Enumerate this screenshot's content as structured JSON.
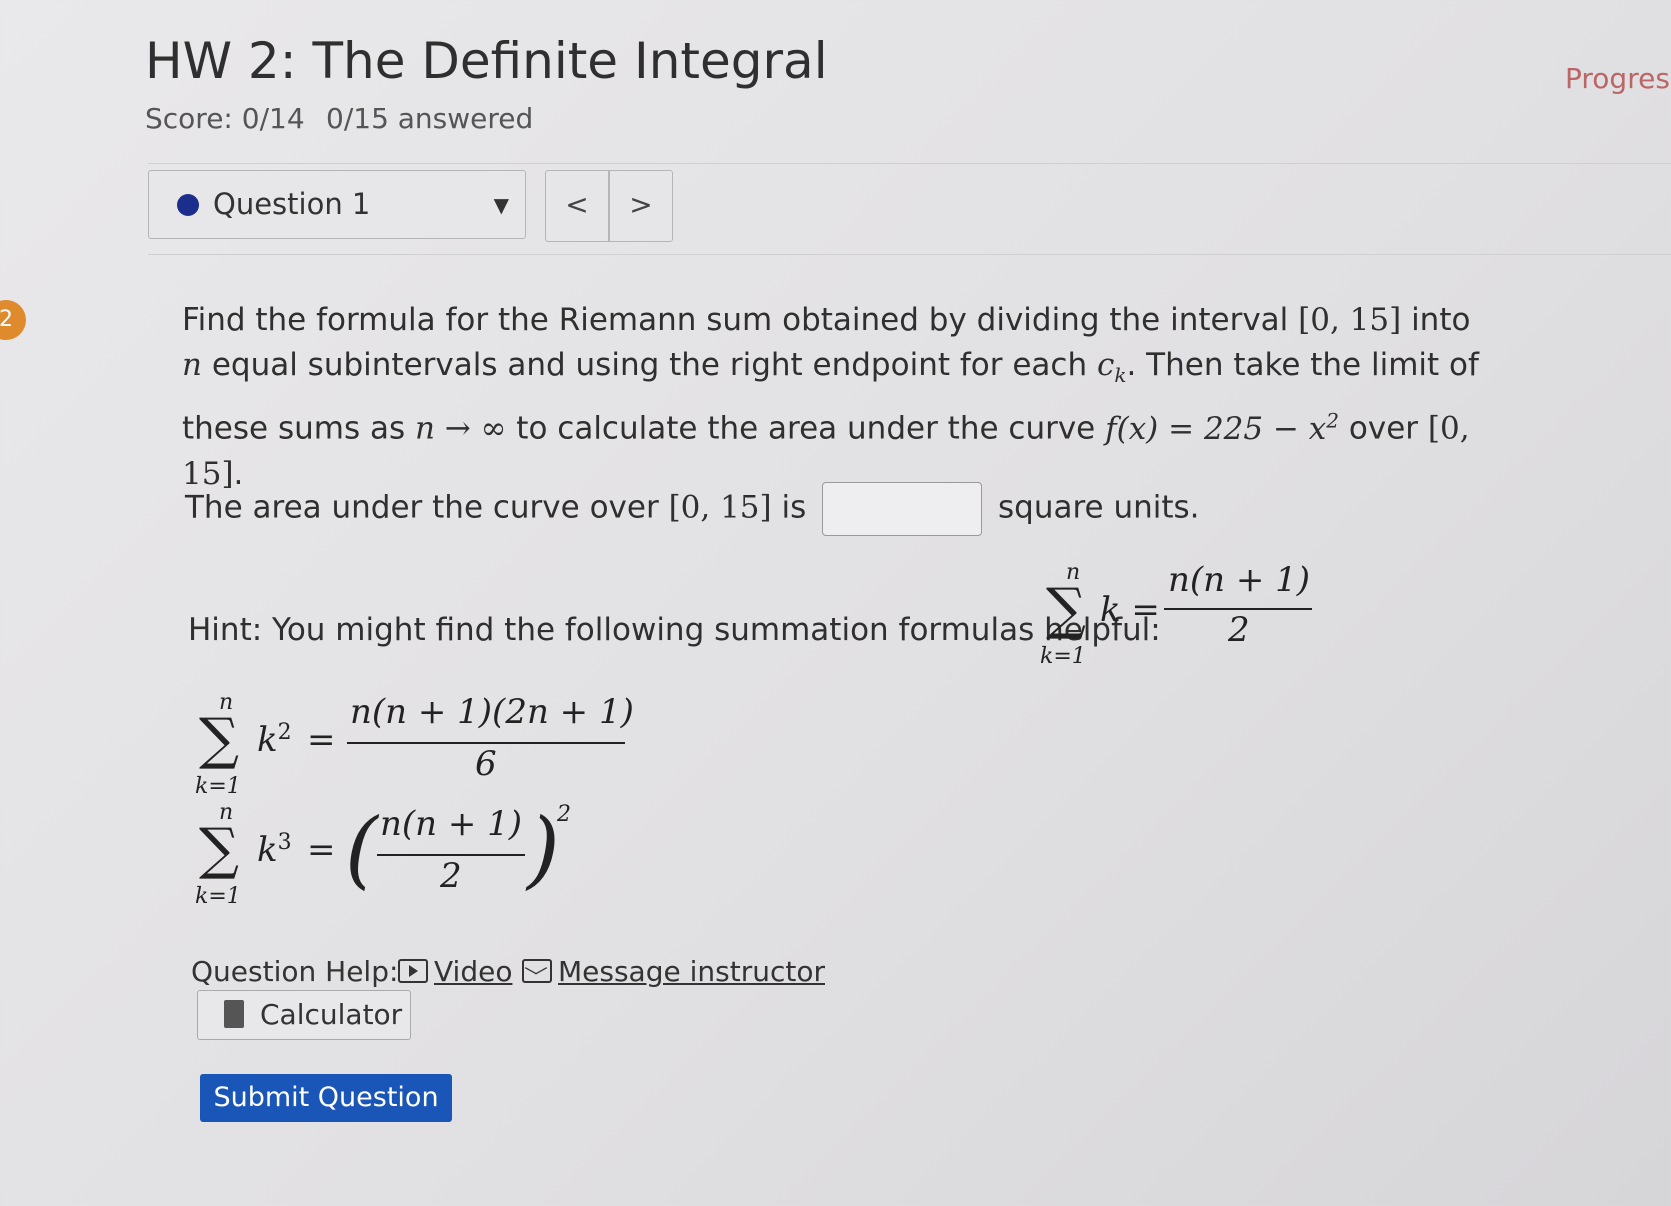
{
  "header": {
    "title": "HW 2: The Definite Integral",
    "score": "Score: 0/14",
    "answered": "0/15 answered",
    "progress": "Progress"
  },
  "navigation": {
    "question_label": "Question 1",
    "prev": "<",
    "next": ">"
  },
  "question": {
    "badge": "2",
    "prompt_p1": "Find the formula for the Riemann sum obtained by dividing the interval ",
    "interval": "[0, 15]",
    "prompt_p2": " into ",
    "n": "n",
    "prompt_p3": " equal subintervals and using the right endpoint for each ",
    "ck": "c",
    "ck_sub": "k",
    "prompt_p4": ". Then take the limit of these sums as ",
    "limit_expr": "n → ∞",
    "prompt_p5": " to calculate the area under the curve ",
    "function": "f(x) = 225 − x",
    "function_exp": "2",
    "prompt_p6": " over ",
    "prompt_p7": ".",
    "area_pre": "The area under the curve over ",
    "area_mid": " is",
    "area_post": "square units.",
    "answer_value": ""
  },
  "hint": {
    "text": "Hint: You might find the following summation formulas helpful:",
    "sigma": "∑",
    "upper": "n",
    "lower": "k=1",
    "f1_term": "k =",
    "f1_num": "n(n + 1)",
    "f1_den": "2",
    "f2_term": "k",
    "f2_exp": "2",
    "eq": "=",
    "f2_num": "n(n + 1)(2n + 1)",
    "f2_den": "6",
    "f3_term": "k",
    "f3_exp": "3",
    "f3_lparen": "(",
    "f3_rparen": ")",
    "f3_num": "n(n + 1)",
    "f3_den": "2",
    "f3_outer_exp": "2"
  },
  "help": {
    "label": "Question Help:",
    "video": "Video",
    "message": "Message instructor",
    "calculator": "Calculator"
  },
  "submit": {
    "label": "Submit Question"
  },
  "colors": {
    "submit_bg": "#1a56b8",
    "dot": "#1b2e8c",
    "badge": "#e08a2e"
  }
}
